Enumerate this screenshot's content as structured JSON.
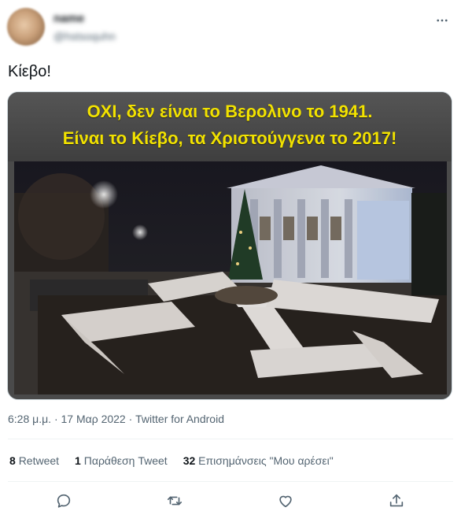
{
  "author": {
    "display_name": "name",
    "handle": "@hstsoquhn"
  },
  "tweet": {
    "text": "Κίεβο!",
    "image_caption_line1": "ΟΧΙ, δεν είναι το Βερολινο το 1941.",
    "image_caption_line2": "Είναι το Κίεβο, τα Χριστούγγενα το 2017!",
    "timestamp": "6:28 μ.μ. · 17 Μαρ 2022 · Twitter for Android"
  },
  "stats": {
    "retweets_count": "8",
    "retweets_label": "Retweet",
    "quotes_count": "1",
    "quotes_label": "Παράθεση Tweet",
    "likes_count": "32",
    "likes_label": "Επισημάνσεις \"Μου αρέσει\""
  },
  "icons": {
    "more": "more-horizontal-icon",
    "reply": "reply-icon",
    "retweet": "retweet-icon",
    "like": "heart-icon",
    "share": "share-icon"
  },
  "colors": {
    "text_primary": "#0f1419",
    "text_secondary": "#536471",
    "caption_yellow": "#f2e200"
  }
}
